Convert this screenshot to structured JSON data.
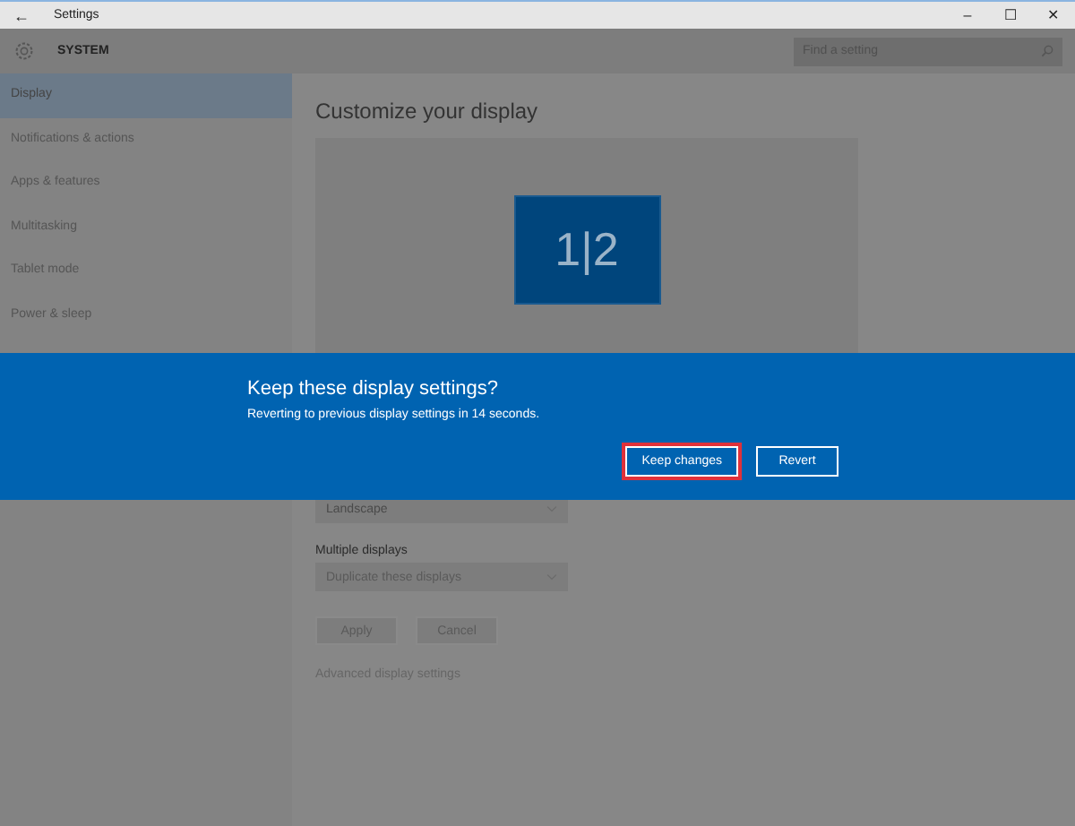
{
  "window": {
    "title": "Settings",
    "back": "←",
    "controls": [
      "–",
      "☐",
      "✕"
    ]
  },
  "header": {
    "title": "SYSTEM",
    "search": {
      "placeholder": "Find a setting"
    }
  },
  "sidebar": {
    "items": [
      {
        "label": "Display",
        "selected": true
      },
      {
        "label": "Notifications & actions",
        "selected": false
      },
      {
        "label": "Apps & features",
        "selected": false
      },
      {
        "label": "Multitasking",
        "selected": false
      },
      {
        "label": "Tablet mode",
        "selected": false
      },
      {
        "label": "Power & sleep",
        "selected": false
      }
    ]
  },
  "content": {
    "title": "Customize your display",
    "monitor": "1|2",
    "orientation": {
      "value": "Landscape"
    },
    "multiple_displays": {
      "label": "Multiple displays",
      "value": "Duplicate these displays"
    },
    "buttons": [
      "Apply",
      "Cancel"
    ],
    "link": "Advanced display settings"
  },
  "dialog": {
    "title": "Keep these display settings?",
    "message": "Reverting to previous display settings in 14 seconds.",
    "buttons": [
      {
        "label": "Keep changes",
        "focused": true
      },
      {
        "label": "Revert",
        "focused": false
      }
    ]
  }
}
